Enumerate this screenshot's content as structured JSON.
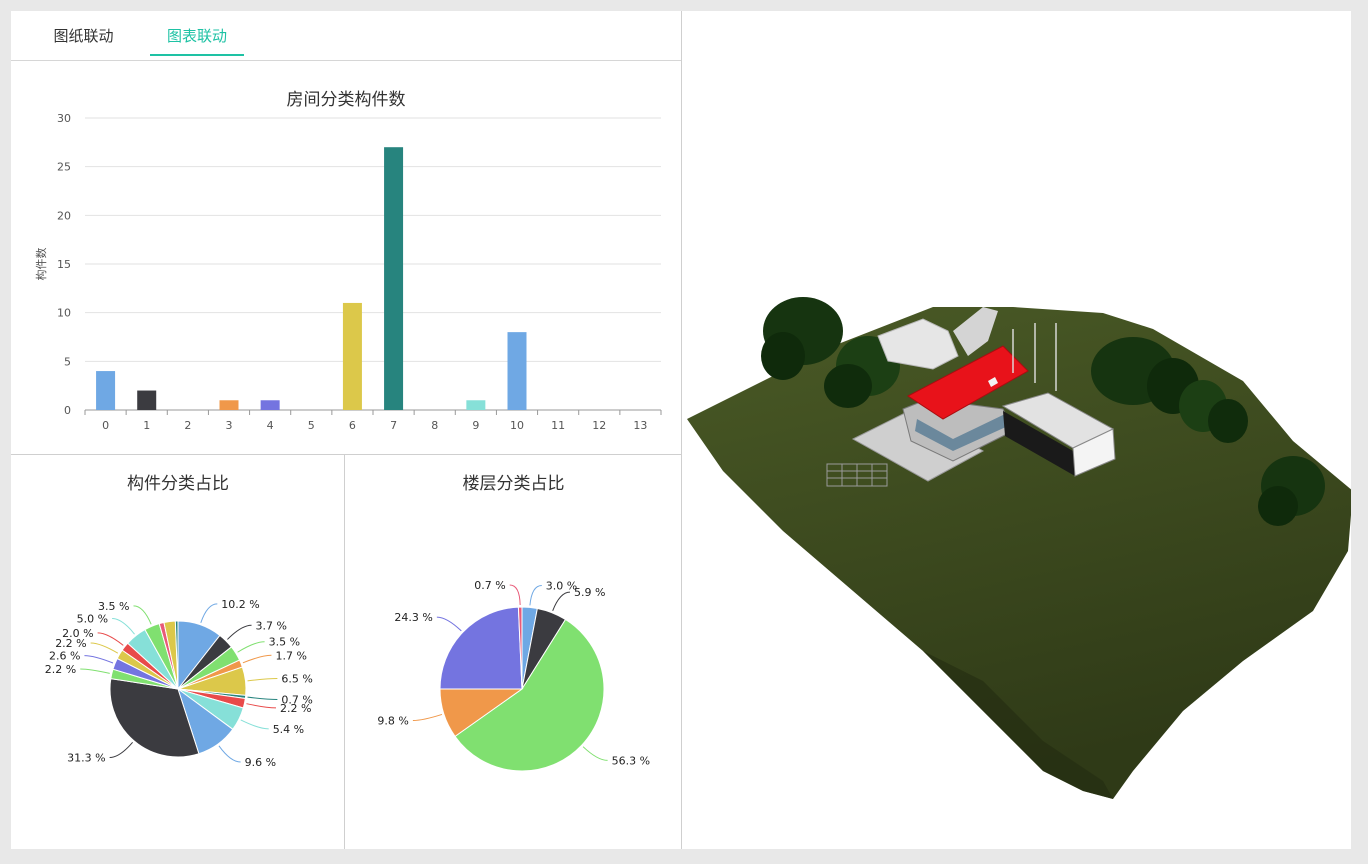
{
  "tabs": [
    {
      "label": "图纸联动",
      "active": false
    },
    {
      "label": "图表联动",
      "active": true
    }
  ],
  "colors": {
    "accent": "#1ec2a4",
    "ground": "#3c4a1d",
    "roof": "#e8121a",
    "tree": "#1a3a14"
  },
  "chart_data": [
    {
      "type": "bar",
      "title": "房间分类构件数",
      "ylabel": "构件数",
      "xlabel": "",
      "categories": [
        "0",
        "1",
        "2",
        "3",
        "4",
        "5",
        "6",
        "7",
        "8",
        "9",
        "10",
        "11",
        "12",
        "13"
      ],
      "values": [
        4,
        2,
        0,
        1,
        1,
        0,
        11,
        27,
        0,
        1,
        8,
        0,
        0,
        0
      ],
      "colors": [
        "#6fa8e4",
        "#3b3b40",
        "#80e070",
        "#f0984a",
        "#7474e0",
        "#e85a78",
        "#dcc84a",
        "#27847e",
        "#e84a4a",
        "#86e0d8",
        "#6fa8e4",
        "#3b3b40",
        "#80e070",
        "#f0984a"
      ],
      "ylim": [
        0,
        30
      ],
      "yticks": [
        "0",
        "5",
        "10",
        "15",
        "20",
        "25",
        "30"
      ],
      "grid": true
    },
    {
      "type": "pie",
      "title": "构件分类占比",
      "slices": [
        {
          "label": "10.2 %",
          "value": 10.2,
          "color": "#6fa8e4"
        },
        {
          "label": "3.7 %",
          "value": 3.7,
          "color": "#3b3b40"
        },
        {
          "label": "3.5 %",
          "value": 3.5,
          "color": "#80e070"
        },
        {
          "label": "1.7 %",
          "value": 1.7,
          "color": "#f0984a"
        },
        {
          "label": "6.5 %",
          "value": 6.5,
          "color": "#dcc84a"
        },
        {
          "label": "0.7 %",
          "value": 0.7,
          "color": "#27847e"
        },
        {
          "label": "2.2 %",
          "value": 2.2,
          "color": "#e84a4a"
        },
        {
          "label": "5.4 %",
          "value": 5.4,
          "color": "#86e0d8"
        },
        {
          "label": "9.6 %",
          "value": 9.6,
          "color": "#6fa8e4"
        },
        {
          "label": "31.3 %",
          "value": 31.3,
          "color": "#3b3b40"
        },
        {
          "label": "2.2 %",
          "value": 2.2,
          "color": "#80e070"
        },
        {
          "label": "2.6 %",
          "value": 2.6,
          "color": "#7474e0"
        },
        {
          "label": "2.2 %",
          "value": 2.2,
          "color": "#dcc84a"
        },
        {
          "label": "2.0 %",
          "value": 2.0,
          "color": "#e84a4a"
        },
        {
          "label": "5.0 %",
          "value": 5.0,
          "color": "#86e0d8"
        },
        {
          "label": "3.5 %",
          "value": 3.5,
          "color": "#80e070"
        },
        {
          "label": "",
          "value": 1.1,
          "color": "#e85a78"
        },
        {
          "label": "",
          "value": 2.6,
          "color": "#dcc84a"
        },
        {
          "label": "",
          "value": 0.6,
          "color": "#27847e"
        }
      ]
    },
    {
      "type": "pie",
      "title": "楼层分类占比",
      "slices": [
        {
          "label": "3.0 %",
          "value": 3.0,
          "color": "#6fa8e4"
        },
        {
          "label": "5.9 %",
          "value": 5.9,
          "color": "#3b3b40"
        },
        {
          "label": "56.3 %",
          "value": 56.3,
          "color": "#80e070"
        },
        {
          "label": "9.8 %",
          "value": 9.8,
          "color": "#f0984a"
        },
        {
          "label": "24.3 %",
          "value": 24.3,
          "color": "#7474e0"
        },
        {
          "label": "0.7 %",
          "value": 0.7,
          "color": "#e85a78"
        }
      ]
    }
  ]
}
